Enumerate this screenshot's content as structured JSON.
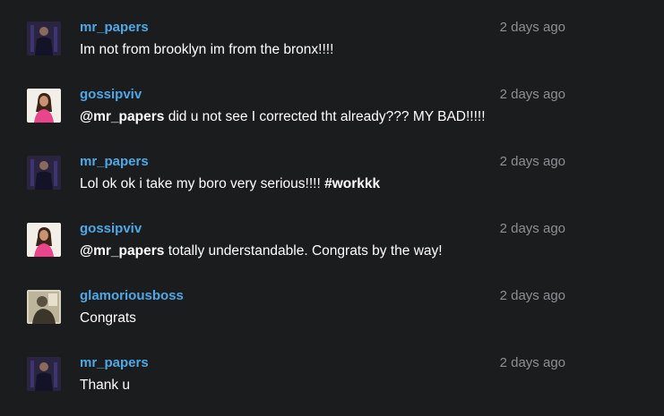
{
  "comments": [
    {
      "username": "mr_papers",
      "avatar_icon": "user-avatar-mr-papers",
      "time": "2 days ago",
      "mention": "",
      "text": "Im not from brooklyn im from the bronx!!!!",
      "hashtag": ""
    },
    {
      "username": "gossipviv",
      "avatar_icon": "user-avatar-gossipviv",
      "time": "2 days ago",
      "mention": "@mr_papers",
      "text": " did u not see I corrected tht already??? MY BAD!!!!!",
      "hashtag": ""
    },
    {
      "username": "mr_papers",
      "avatar_icon": "user-avatar-mr-papers",
      "time": "2 days ago",
      "mention": "",
      "text": "Lol ok ok i take my boro very serious!!!! ",
      "hashtag": "#workkk"
    },
    {
      "username": "gossipviv",
      "avatar_icon": "user-avatar-gossipviv",
      "time": "2 days ago",
      "mention": "@mr_papers",
      "text": " totally understandable. Congrats by the way!",
      "hashtag": ""
    },
    {
      "username": "glamoriousboss",
      "avatar_icon": "user-avatar-glamoriousboss",
      "time": "2 days ago",
      "mention": "",
      "text": "Congrats",
      "hashtag": ""
    },
    {
      "username": "mr_papers",
      "avatar_icon": "user-avatar-mr-papers",
      "time": "2 days ago",
      "mention": "",
      "text": "Thank u",
      "hashtag": ""
    }
  ],
  "colors": {
    "background": "#1b1c1e",
    "username": "#4ea8e6",
    "timestamp": "#8e8f92",
    "text": "#ffffff"
  }
}
